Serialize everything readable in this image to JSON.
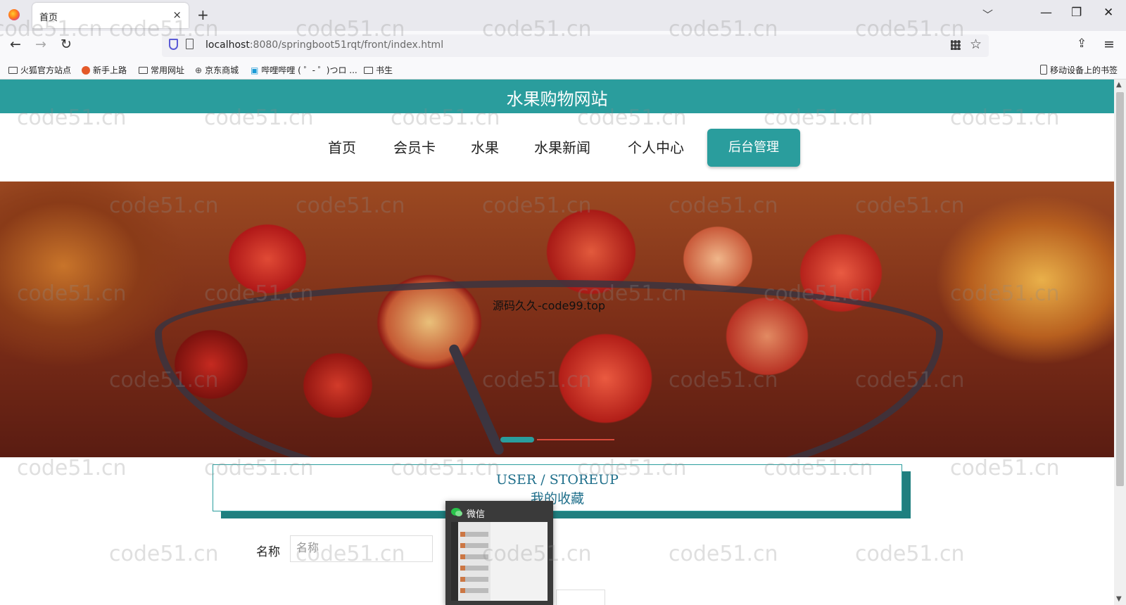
{
  "browser": {
    "tab_title": "首页",
    "tab_close": "×",
    "new_tab": "+",
    "tab_list": "﹀",
    "window": {
      "minimize": "—",
      "restore": "❐",
      "close": "✕"
    },
    "nav": {
      "back": "←",
      "forward": "→",
      "reload": "↻",
      "extensions": "⇪",
      "menu": "≡"
    },
    "url_host": "localhost",
    "url_path": ":8080/springboot51rqt/front/index.html",
    "star": "☆",
    "bookmarks": [
      "火狐官方站点",
      "新手上路",
      "常用网址",
      "京东商城",
      "哔哩哔哩 ( ゜- ゜)つロ ...",
      "书生"
    ],
    "mobile_bookmarks": "移动设备上的书签"
  },
  "site": {
    "title": "水果购物网站",
    "menu": [
      "首页",
      "会员卡",
      "水果",
      "水果新闻",
      "个人中心"
    ],
    "admin_button": "后台管理",
    "banner_caption": "源码久久-code99.top",
    "section": {
      "en": "USER / STOREUP",
      "cn": "我的收藏"
    },
    "form": {
      "name_label": "名称",
      "name_placeholder": "名称"
    }
  },
  "wechat": {
    "title": "微信"
  },
  "watermark": "code51.cn",
  "colors": {
    "accent": "#2a9d9d",
    "section_text": "#1f6f8b"
  }
}
